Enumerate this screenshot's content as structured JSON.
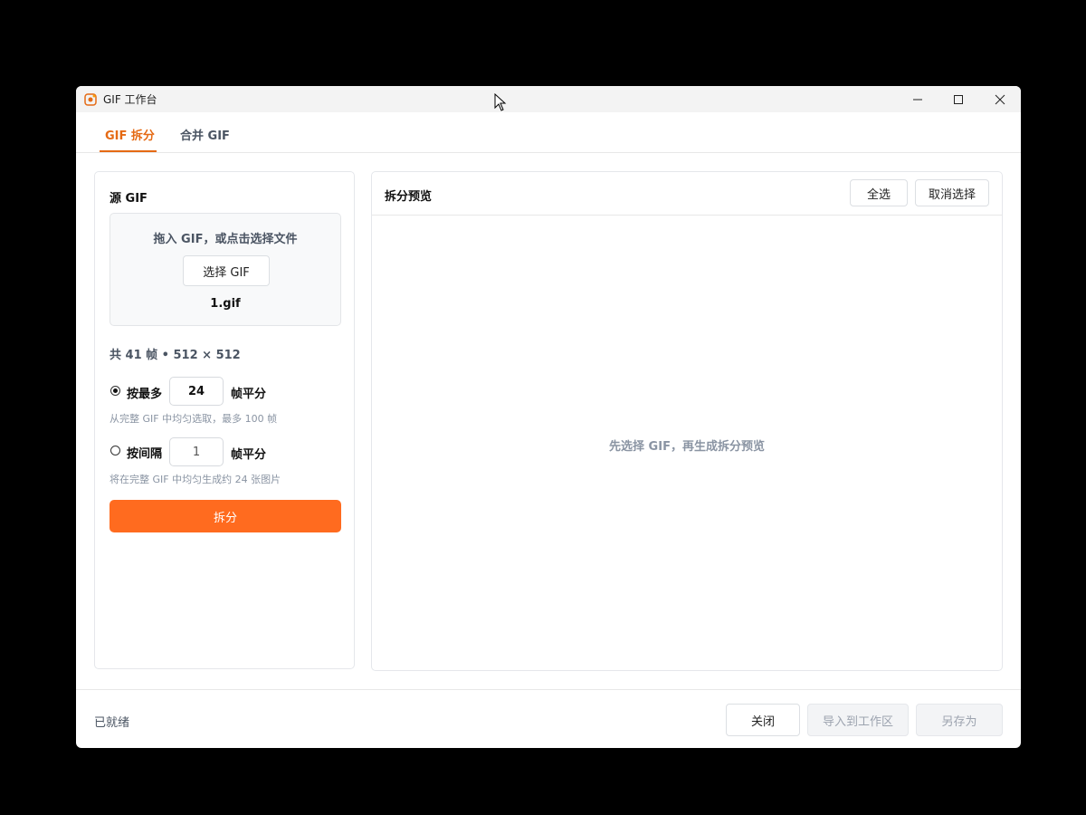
{
  "window": {
    "title": "GIF 工作台",
    "icon": "gif-app-icon",
    "controls": [
      "minimize-icon",
      "maximize-icon",
      "close-icon"
    ]
  },
  "tabs": [
    {
      "label": "GIF 拆分",
      "active": true
    },
    {
      "label": "合并 GIF",
      "active": false
    }
  ],
  "source": {
    "title": "源 GIF",
    "drop_hint": "拖入 GIF，或点击选择文件",
    "choose_button": "选择 GIF",
    "file_name": "1.gif",
    "frame_info": "共 41 帧 • 512 × 512",
    "option_max": {
      "label": "按最多",
      "value": "24",
      "unit": "帧平分",
      "checked": true,
      "help": "从完整 GIF 中均匀选取，最多 100 帧"
    },
    "option_interval": {
      "label": "按间隔",
      "value": "1",
      "unit": "帧平分",
      "checked": false,
      "help": "将在完整 GIF 中均匀生成约 24 张图片"
    },
    "split_button": "拆分"
  },
  "preview": {
    "title": "拆分预览",
    "select_all": "全选",
    "deselect": "取消选择",
    "empty_text": "先选择 GIF，再生成拆分预览"
  },
  "footer": {
    "status": "已就绪",
    "close": "关闭",
    "import": "导入到工作区",
    "save_as": "另存为"
  },
  "colors": {
    "accent": "#ff6b1f",
    "tab_active": "#e56a14",
    "muted": "#8a94a3"
  }
}
